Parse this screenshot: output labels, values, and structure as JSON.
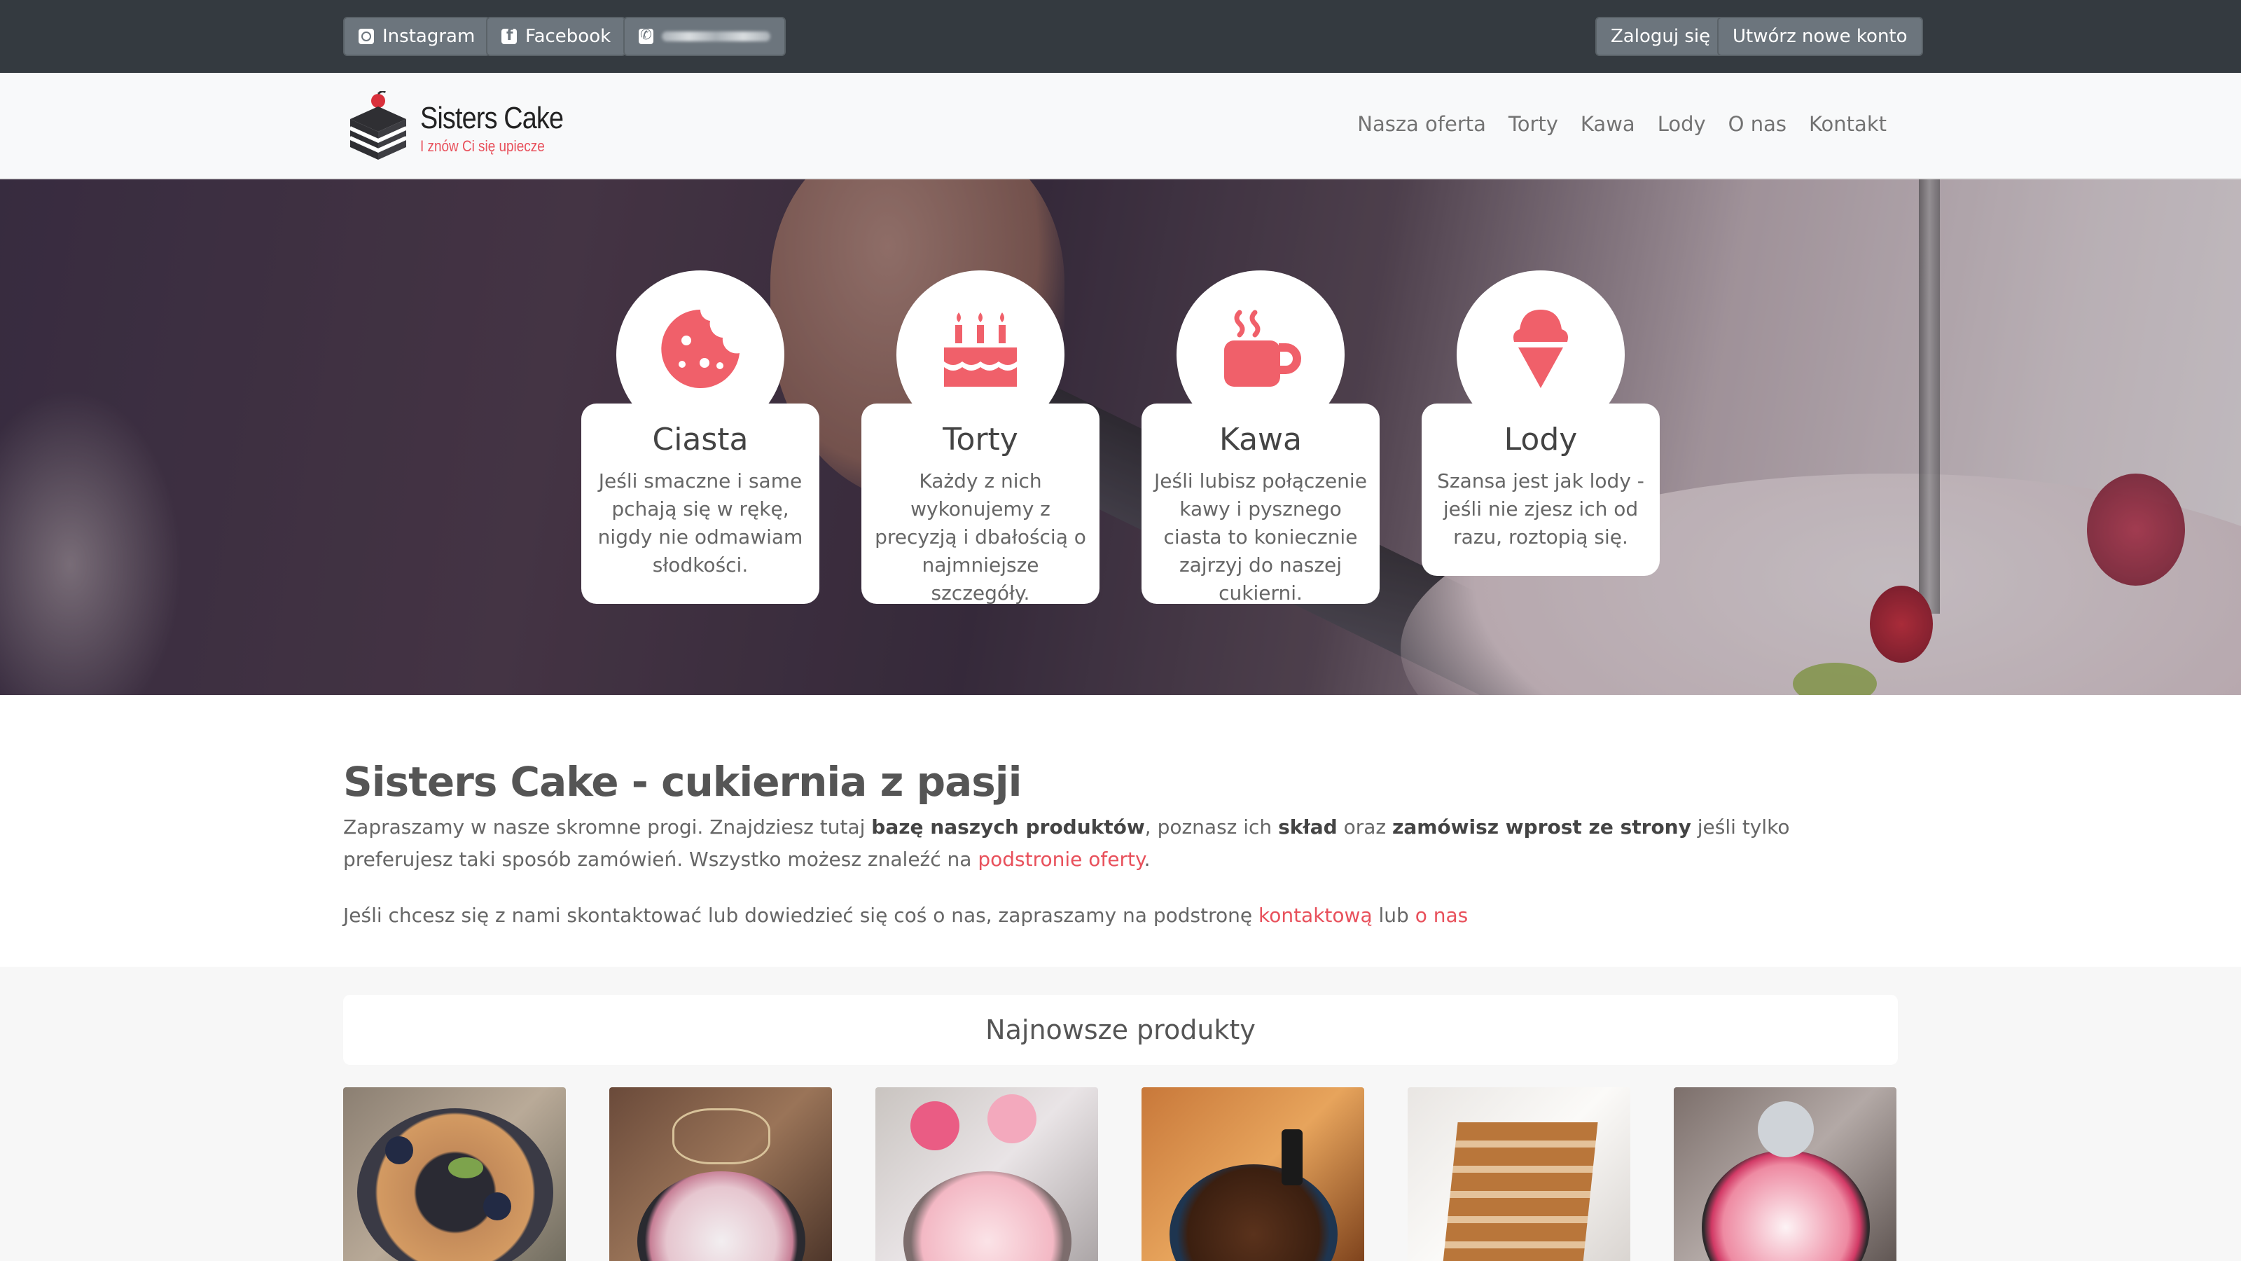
{
  "topbar": {
    "instagram": "Instagram",
    "facebook": "Facebook",
    "login": "Zaloguj się",
    "register": "Utwórz nowe konto"
  },
  "brand": {
    "name": "Sisters Cake",
    "tagline": "I znów Ci się upiecze"
  },
  "nav": [
    "Nasza oferta",
    "Torty",
    "Kawa",
    "Lody",
    "O nas",
    "Kontakt"
  ],
  "cards": [
    {
      "title": "Ciasta",
      "text": "Jeśli smaczne i same pchają się w rękę, nigdy nie odmawiam słodkości.",
      "icon": "cookie-icon"
    },
    {
      "title": "Torty",
      "text": "Każdy z nich wykonujemy z precyzją i dbałością o najmniejsze szczegóły.",
      "icon": "birthday-cake-icon"
    },
    {
      "title": "Kawa",
      "text": "Jeśli lubisz połączenie kawy i pysznego ciasta to koniecznie zajrzyj do naszej cukierni.",
      "icon": "coffee-cup-icon"
    },
    {
      "title": "Lody",
      "text": "Szansa jest jak lody - jeśli nie zjesz ich od razu, roztopią się.",
      "icon": "ice-cream-icon"
    }
  ],
  "intro": {
    "title": "Sisters Cake - cukiernia z pasji",
    "p1_a": "Zapraszamy w nasze skromne progi. Znajdziesz tutaj ",
    "p1_b": "bazę naszych produktów",
    "p1_c": ", poznasz ich ",
    "p1_d": "skład",
    "p1_e": " oraz ",
    "p1_f": "zamówisz wprost ze strony",
    "p1_g": " jeśli tylko preferujesz taki sposób zamówień. Wszystko możesz znaleźć na ",
    "p1_link": "podstronie oferty",
    "p1_end": ".",
    "p2_a": "Jeśli chcesz się z nami skontaktować lub dowiedzieć się coś o nas, zapraszamy na podstronę ",
    "p2_link1": "kontaktową",
    "p2_b": " lub ",
    "p2_link2": "o nas"
  },
  "products": {
    "header": "Najnowsze produkty"
  },
  "colors": {
    "accent": "#e8505b",
    "icon": "#f0606a",
    "topbar": "#343a40"
  }
}
